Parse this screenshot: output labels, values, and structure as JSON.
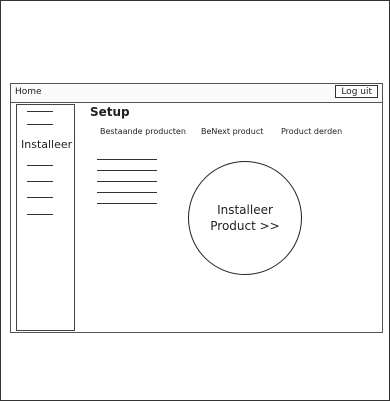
{
  "header": {
    "home": "Home",
    "logout": "Log uit"
  },
  "sidebar": {
    "active_label": "Installeer"
  },
  "main": {
    "title": "Setup",
    "tabs": [
      {
        "label": "Bestaande producten"
      },
      {
        "label": "BeNext product"
      },
      {
        "label": "Product derden"
      }
    ],
    "install_button": {
      "line1": "Installeer",
      "line2": "Product >>"
    }
  }
}
